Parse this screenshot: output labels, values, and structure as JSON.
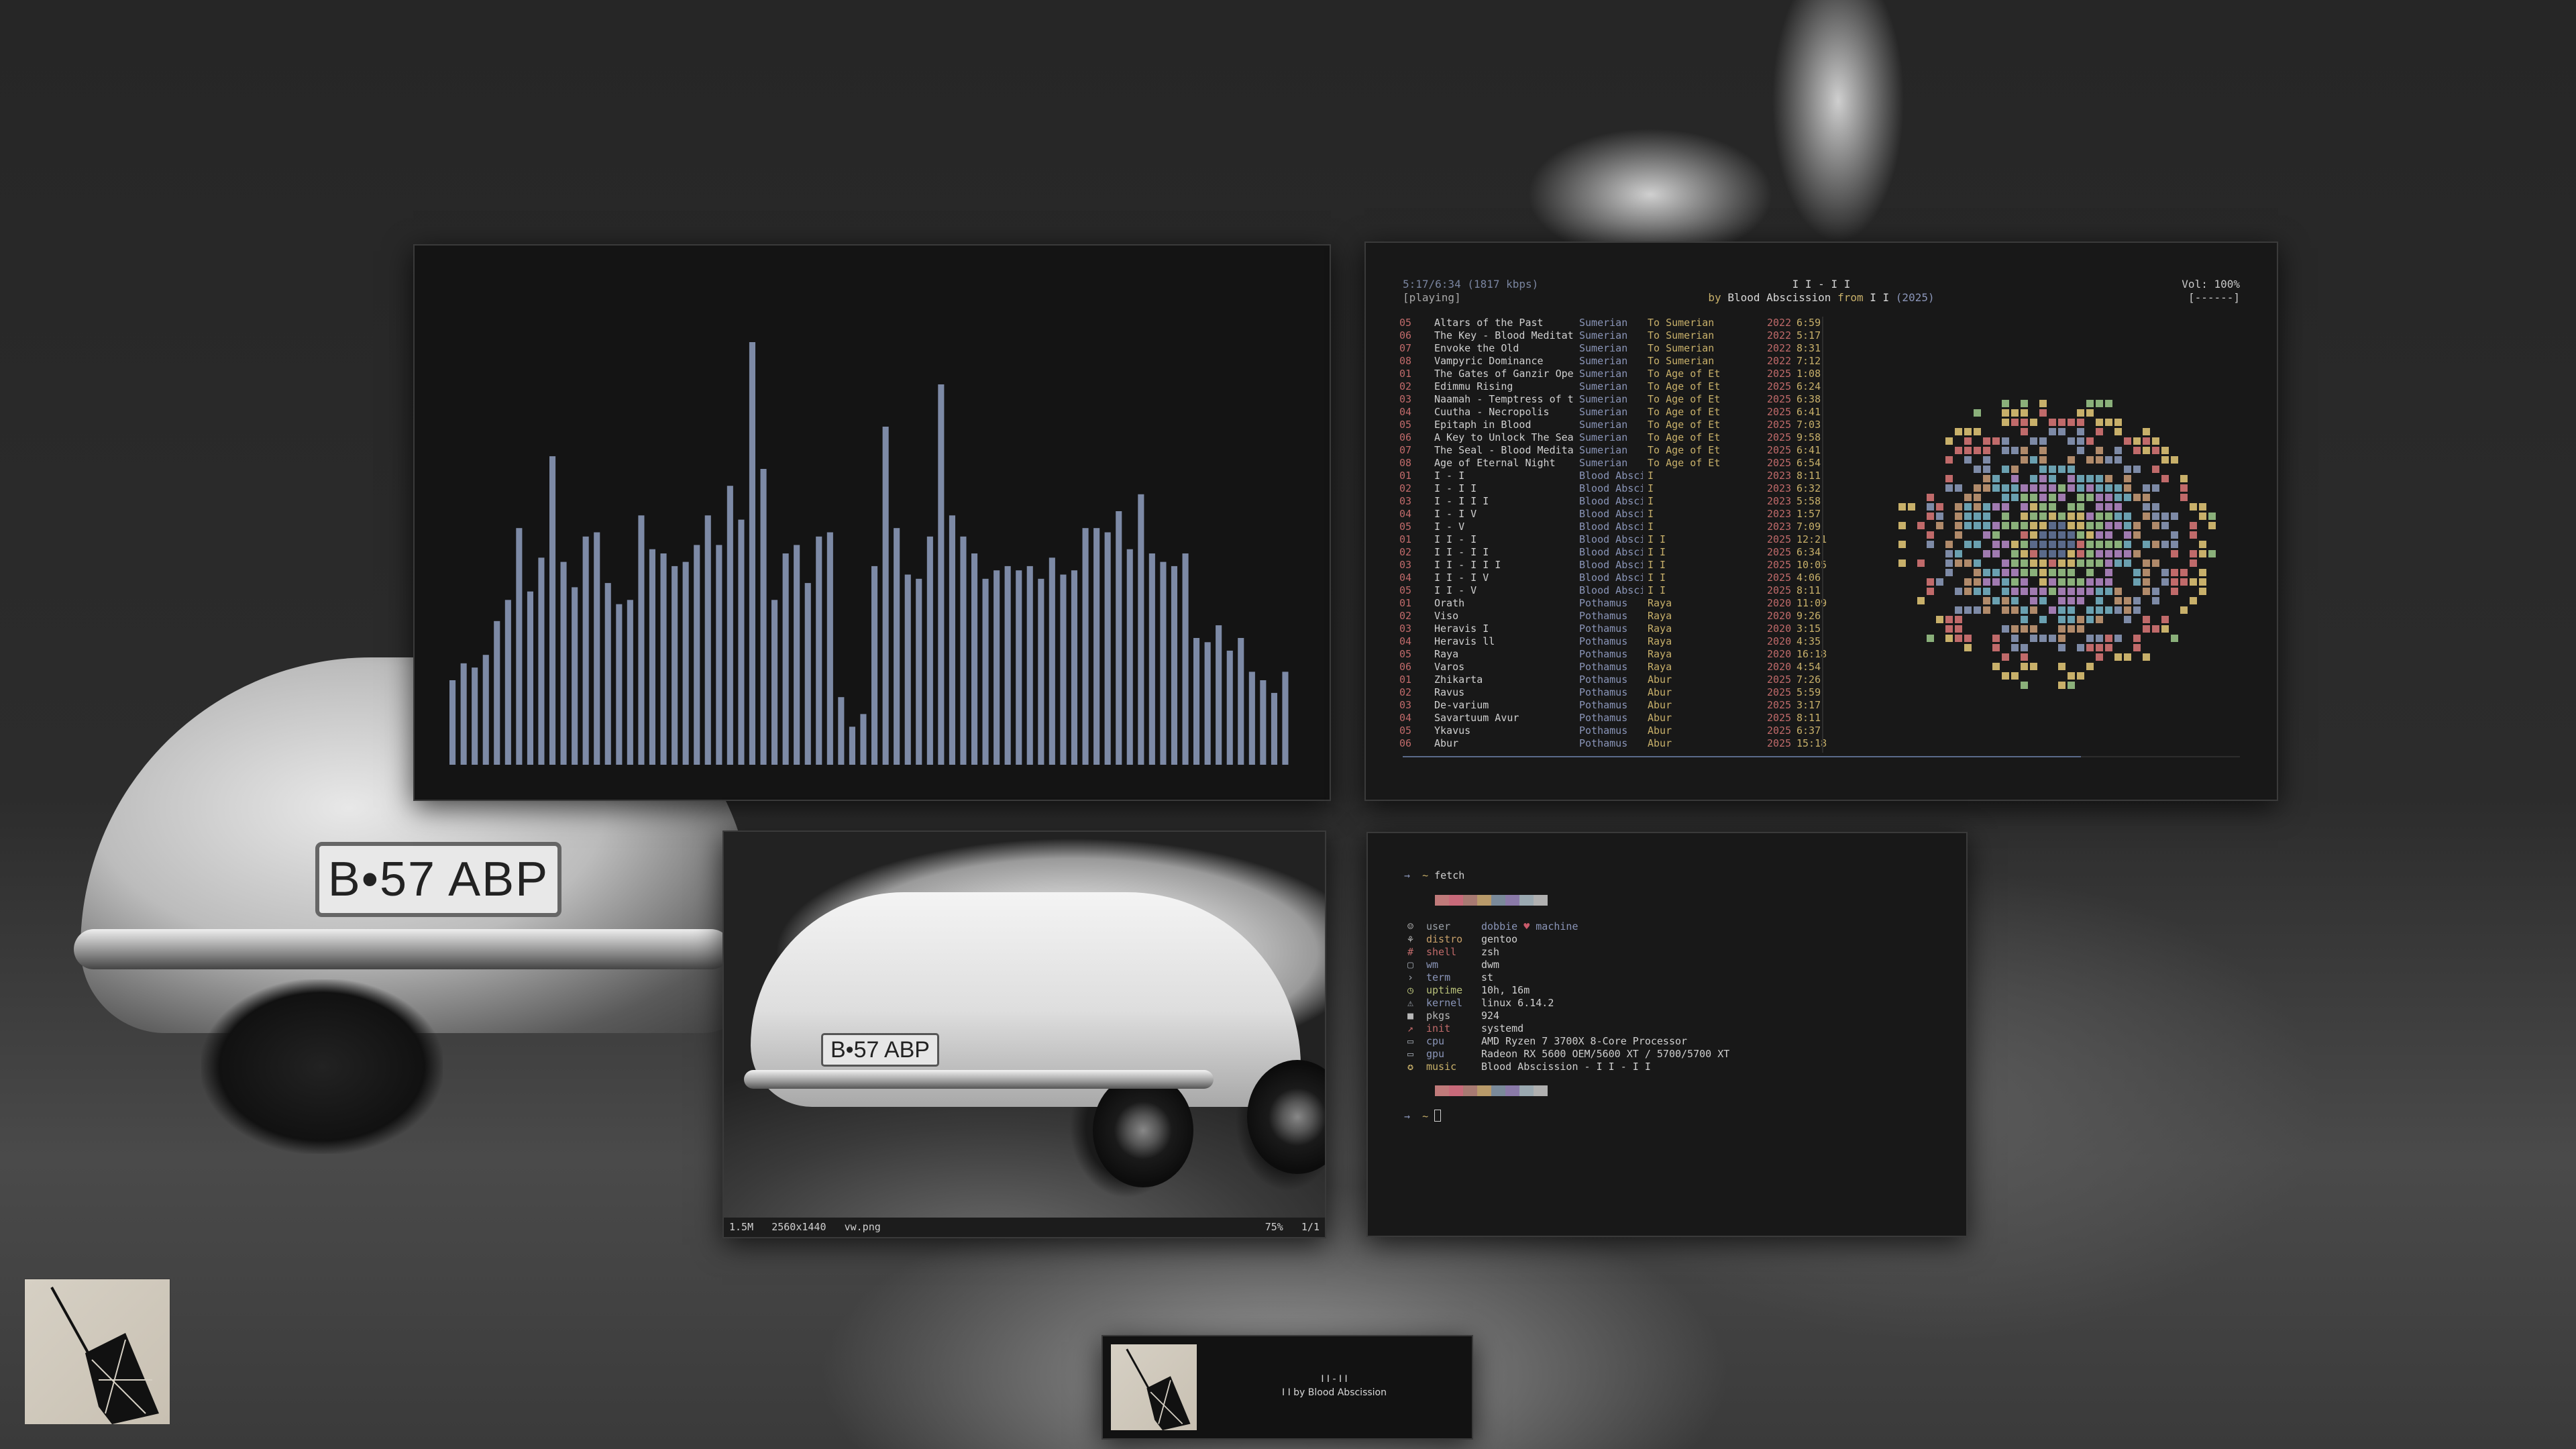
{
  "wallpaper": {
    "plate": "B•57 ABP"
  },
  "visualizer": {
    "bar_color": "#7d8aa6",
    "levels": [
      0.2,
      0.24,
      0.23,
      0.26,
      0.34,
      0.39,
      0.56,
      0.41,
      0.49,
      0.73,
      0.48,
      0.42,
      0.54,
      0.55,
      0.43,
      0.38,
      0.39,
      0.59,
      0.51,
      0.5,
      0.47,
      0.48,
      0.52,
      0.59,
      0.52,
      0.66,
      0.58,
      1.0,
      0.7,
      0.39,
      0.5,
      0.52,
      0.43,
      0.54,
      0.55,
      0.16,
      0.09,
      0.12,
      0.47,
      0.8,
      0.56,
      0.45,
      0.44,
      0.54,
      0.9,
      0.59,
      0.54,
      0.5,
      0.44,
      0.46,
      0.47,
      0.46,
      0.47,
      0.44,
      0.49,
      0.45,
      0.46,
      0.56,
      0.56,
      0.55,
      0.6,
      0.51,
      0.64,
      0.5,
      0.48,
      0.47,
      0.5,
      0.3,
      0.29,
      0.33,
      0.27,
      0.3,
      0.22,
      0.2,
      0.17,
      0.22
    ]
  },
  "player": {
    "time": "5:17/6:34 (1817 kbps)",
    "state": "[playing]",
    "title": "I I - I I",
    "by": "by",
    "artist": "Blood Abscission",
    "from": "from",
    "album": "I I",
    "year": "(2025)",
    "volume": "Vol: 100%",
    "volume_bar": "[------]",
    "progress": 0.81,
    "tracks": [
      {
        "no": "05",
        "title": "Altars of the Past",
        "artist": "Sumerian",
        "album": "To Sumerian",
        "year": "2022",
        "dur": "6:59"
      },
      {
        "no": "06",
        "title": "The Key - Blood Meditat",
        "artist": "Sumerian",
        "album": "To Sumerian",
        "year": "2022",
        "dur": "5:17"
      },
      {
        "no": "07",
        "title": "Envoke the Old",
        "artist": "Sumerian",
        "album": "To Sumerian",
        "year": "2022",
        "dur": "8:31"
      },
      {
        "no": "08",
        "title": "Vampyric Dominance",
        "artist": "Sumerian",
        "album": "To Sumerian",
        "year": "2022",
        "dur": "7:12"
      },
      {
        "no": "01",
        "title": "The Gates of Ganzir Ope",
        "artist": "Sumerian",
        "album": "To Age of Et",
        "year": "2025",
        "dur": "1:08"
      },
      {
        "no": "02",
        "title": "Edimmu Rising",
        "artist": "Sumerian",
        "album": "To Age of Et",
        "year": "2025",
        "dur": "6:24"
      },
      {
        "no": "03",
        "title": "Naamah - Temptress of t",
        "artist": "Sumerian",
        "album": "To Age of Et",
        "year": "2025",
        "dur": "6:38"
      },
      {
        "no": "04",
        "title": "Cuutha - Necropolis",
        "artist": "Sumerian",
        "album": "To Age of Et",
        "year": "2025",
        "dur": "6:41"
      },
      {
        "no": "05",
        "title": "Epitaph in Blood",
        "artist": "Sumerian",
        "album": "To Age of Et",
        "year": "2025",
        "dur": "7:03"
      },
      {
        "no": "06",
        "title": "A Key to Unlock The Sea",
        "artist": "Sumerian",
        "album": "To Age of Et",
        "year": "2025",
        "dur": "9:58"
      },
      {
        "no": "07",
        "title": "The Seal - Blood Medita",
        "artist": "Sumerian",
        "album": "To Age of Et",
        "year": "2025",
        "dur": "6:41"
      },
      {
        "no": "08",
        "title": "Age of Eternal Night",
        "artist": "Sumerian",
        "album": "To Age of Et",
        "year": "2025",
        "dur": "6:54"
      },
      {
        "no": "01",
        "title": "I - I",
        "artist": "Blood Absci",
        "album": "I",
        "year": "2023",
        "dur": "8:11"
      },
      {
        "no": "02",
        "title": "I - I I",
        "artist": "Blood Absci",
        "album": "I",
        "year": "2023",
        "dur": "6:32"
      },
      {
        "no": "03",
        "title": "I - I I I",
        "artist": "Blood Absci",
        "album": "I",
        "year": "2023",
        "dur": "5:58"
      },
      {
        "no": "04",
        "title": "I - I V",
        "artist": "Blood Absci",
        "album": "I",
        "year": "2023",
        "dur": "1:57"
      },
      {
        "no": "05",
        "title": "I - V",
        "artist": "Blood Absci",
        "album": "I",
        "year": "2023",
        "dur": "7:09"
      },
      {
        "no": "01",
        "title": "I I - I",
        "artist": "Blood Absci",
        "album": "I I",
        "year": "2025",
        "dur": "12:21"
      },
      {
        "no": "02",
        "title": "I I - I I",
        "artist": "Blood Absci",
        "album": "I I",
        "year": "2025",
        "dur": "6:34"
      },
      {
        "no": "03",
        "title": "I I - I I I",
        "artist": "Blood Absci",
        "album": "I I",
        "year": "2025",
        "dur": "10:05"
      },
      {
        "no": "04",
        "title": "I I - I V",
        "artist": "Blood Absci",
        "album": "I I",
        "year": "2025",
        "dur": "4:06"
      },
      {
        "no": "05",
        "title": "I I - V",
        "artist": "Blood Absci",
        "album": "I I",
        "year": "2025",
        "dur": "8:11"
      },
      {
        "no": "01",
        "title": "Orath",
        "artist": "Pothamus",
        "album": "Raya",
        "year": "2020",
        "dur": "11:09"
      },
      {
        "no": "02",
        "title": "Viso",
        "artist": "Pothamus",
        "album": "Raya",
        "year": "2020",
        "dur": "9:26"
      },
      {
        "no": "03",
        "title": "Heravis I",
        "artist": "Pothamus",
        "album": "Raya",
        "year": "2020",
        "dur": "3:15"
      },
      {
        "no": "04",
        "title": "Heravis ll",
        "artist": "Pothamus",
        "album": "Raya",
        "year": "2020",
        "dur": "4:35"
      },
      {
        "no": "05",
        "title": "Raya",
        "artist": "Pothamus",
        "album": "Raya",
        "year": "2020",
        "dur": "16:18"
      },
      {
        "no": "06",
        "title": "Varos",
        "artist": "Pothamus",
        "album": "Raya",
        "year": "2020",
        "dur": "4:54"
      },
      {
        "no": "01",
        "title": "Zhikarta",
        "artist": "Pothamus",
        "album": "Abur",
        "year": "2025",
        "dur": "7:26"
      },
      {
        "no": "02",
        "title": "Ravus",
        "artist": "Pothamus",
        "album": "Abur",
        "year": "2025",
        "dur": "5:59"
      },
      {
        "no": "03",
        "title": "De-varium",
        "artist": "Pothamus",
        "album": "Abur",
        "year": "2025",
        "dur": "3:17"
      },
      {
        "no": "04",
        "title": "Savartuum Avur",
        "artist": "Pothamus",
        "album": "Abur",
        "year": "2025",
        "dur": "8:11"
      },
      {
        "no": "05",
        "title": "Ykavus",
        "artist": "Pothamus",
        "album": "Abur",
        "year": "2025",
        "dur": "6:37"
      },
      {
        "no": "06",
        "title": "Abur",
        "artist": "Pothamus",
        "album": "Abur",
        "year": "2025",
        "dur": "15:18"
      }
    ],
    "art_palette": [
      "#7d8aa6",
      "#c06a6a",
      "#c8b06a",
      "#8ab07a",
      "#a07ab0",
      "#6aa0b0",
      "#b08a6a"
    ]
  },
  "viewer": {
    "plate": "B•57 ABP",
    "filesize": "1.5M",
    "resolution": "2560x1440",
    "filename": "vw.png",
    "zoom": "75%",
    "page": "1/1"
  },
  "fetch": {
    "prompt_arrow": "→",
    "prompt_dir": "~",
    "command": "fetch",
    "swatches": [
      "#c07a7a",
      "#c86a7a",
      "#a87a72",
      "#b89a6a",
      "#7a8a9a",
      "#8a7aa8",
      "#9aa8b0",
      "#b0b0b0"
    ],
    "rows": [
      {
        "icon": "☺",
        "icon_color": "#b8b8b8",
        "key": "user",
        "key_color": "#9aa0a8",
        "value": "dobbie",
        "heart": "♥",
        "value2": "machine"
      },
      {
        "icon": "⚘",
        "icon_color": "#b8b8b8",
        "key": "distro",
        "key_color": "#c8a06a",
        "value": "gentoo"
      },
      {
        "icon": "#",
        "icon_color": "#c06a6a",
        "key": "shell",
        "key_color": "#c06a6a",
        "value": "zsh"
      },
      {
        "icon": "▢",
        "icon_color": "#9aa0a8",
        "key": "wm",
        "key_color": "#8a95b8",
        "value": "dwm"
      },
      {
        "icon": "›",
        "icon_color": "#9aa0a8",
        "key": "term",
        "key_color": "#8a95b8",
        "value": "st"
      },
      {
        "icon": "◷",
        "icon_color": "#b8c07a",
        "key": "uptime",
        "key_color": "#b8c07a",
        "value": "10h, 16m"
      },
      {
        "icon": "⚠",
        "icon_color": "#9aa0a8",
        "key": "kernel",
        "key_color": "#8a95b8",
        "value": "linux 6.14.2"
      },
      {
        "icon": "■",
        "icon_color": "#b8b8b8",
        "key": "pkgs",
        "key_color": "#b8b8b8",
        "value": "924"
      },
      {
        "icon": "↗",
        "icon_color": "#c06a6a",
        "key": "init",
        "key_color": "#c06a6a",
        "value": "systemd"
      },
      {
        "icon": "▭",
        "icon_color": "#9aa0a8",
        "key": "cpu",
        "key_color": "#8a95b8",
        "value": "AMD Ryzen 7 3700X 8-Core Processor"
      },
      {
        "icon": "▭",
        "icon_color": "#9aa0a8",
        "key": "gpu",
        "key_color": "#8a95b8",
        "value": "Radeon RX 5600 OEM/5600 XT / 5700/5700 XT"
      },
      {
        "icon": "✪",
        "icon_color": "#c8b06a",
        "key": "music",
        "key_color": "#c8b06a",
        "value": "Blood Abscission - I I - I I"
      }
    ]
  },
  "now_playing": {
    "title": "I I - I I",
    "subtitle": "I I by Blood Abscission"
  }
}
